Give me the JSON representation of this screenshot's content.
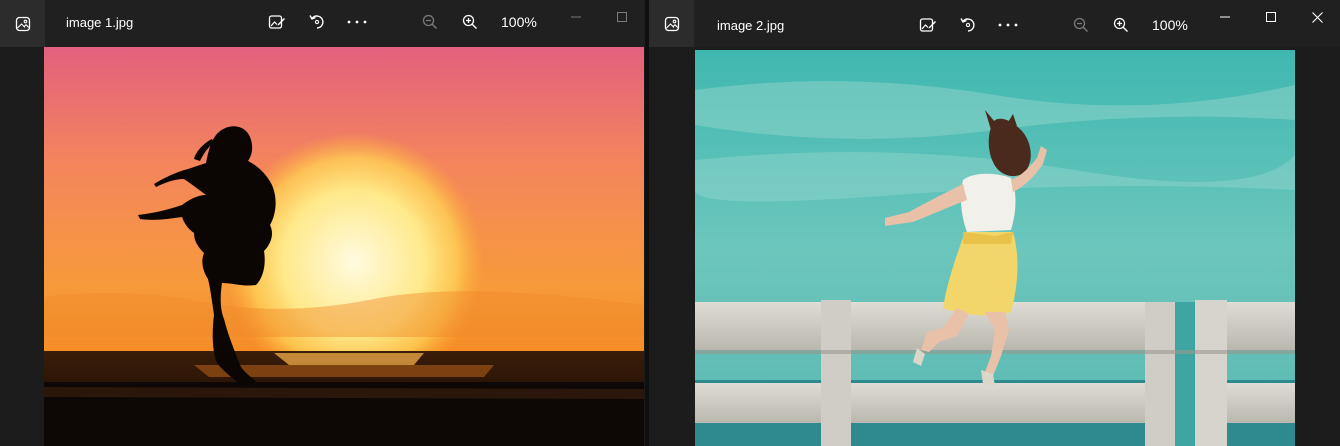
{
  "windows": [
    {
      "title": "image 1.jpg",
      "zoom": "100%",
      "icons": [
        "photos-app-icon",
        "edit-image-icon",
        "rotate-icon",
        "more-options-icon",
        "zoom-out-icon",
        "zoom-in-icon",
        "minimize-icon",
        "maximize-icon"
      ]
    },
    {
      "title": "image 2.jpg",
      "zoom": "100%",
      "icons": [
        "photos-app-icon",
        "edit-image-icon",
        "rotate-icon",
        "more-options-icon",
        "zoom-out-icon",
        "zoom-in-icon",
        "minimize-icon",
        "maximize-icon",
        "close-icon"
      ]
    }
  ],
  "colors": {
    "titlebar": "#202020",
    "icon": "#ffffff",
    "icon_disabled": "#7a7a7a",
    "sunset_top": "#e0607e",
    "sunset_mid": "#f79a3a",
    "sky_teal": "#3fb8b0",
    "railing": "#d8d6cf"
  }
}
